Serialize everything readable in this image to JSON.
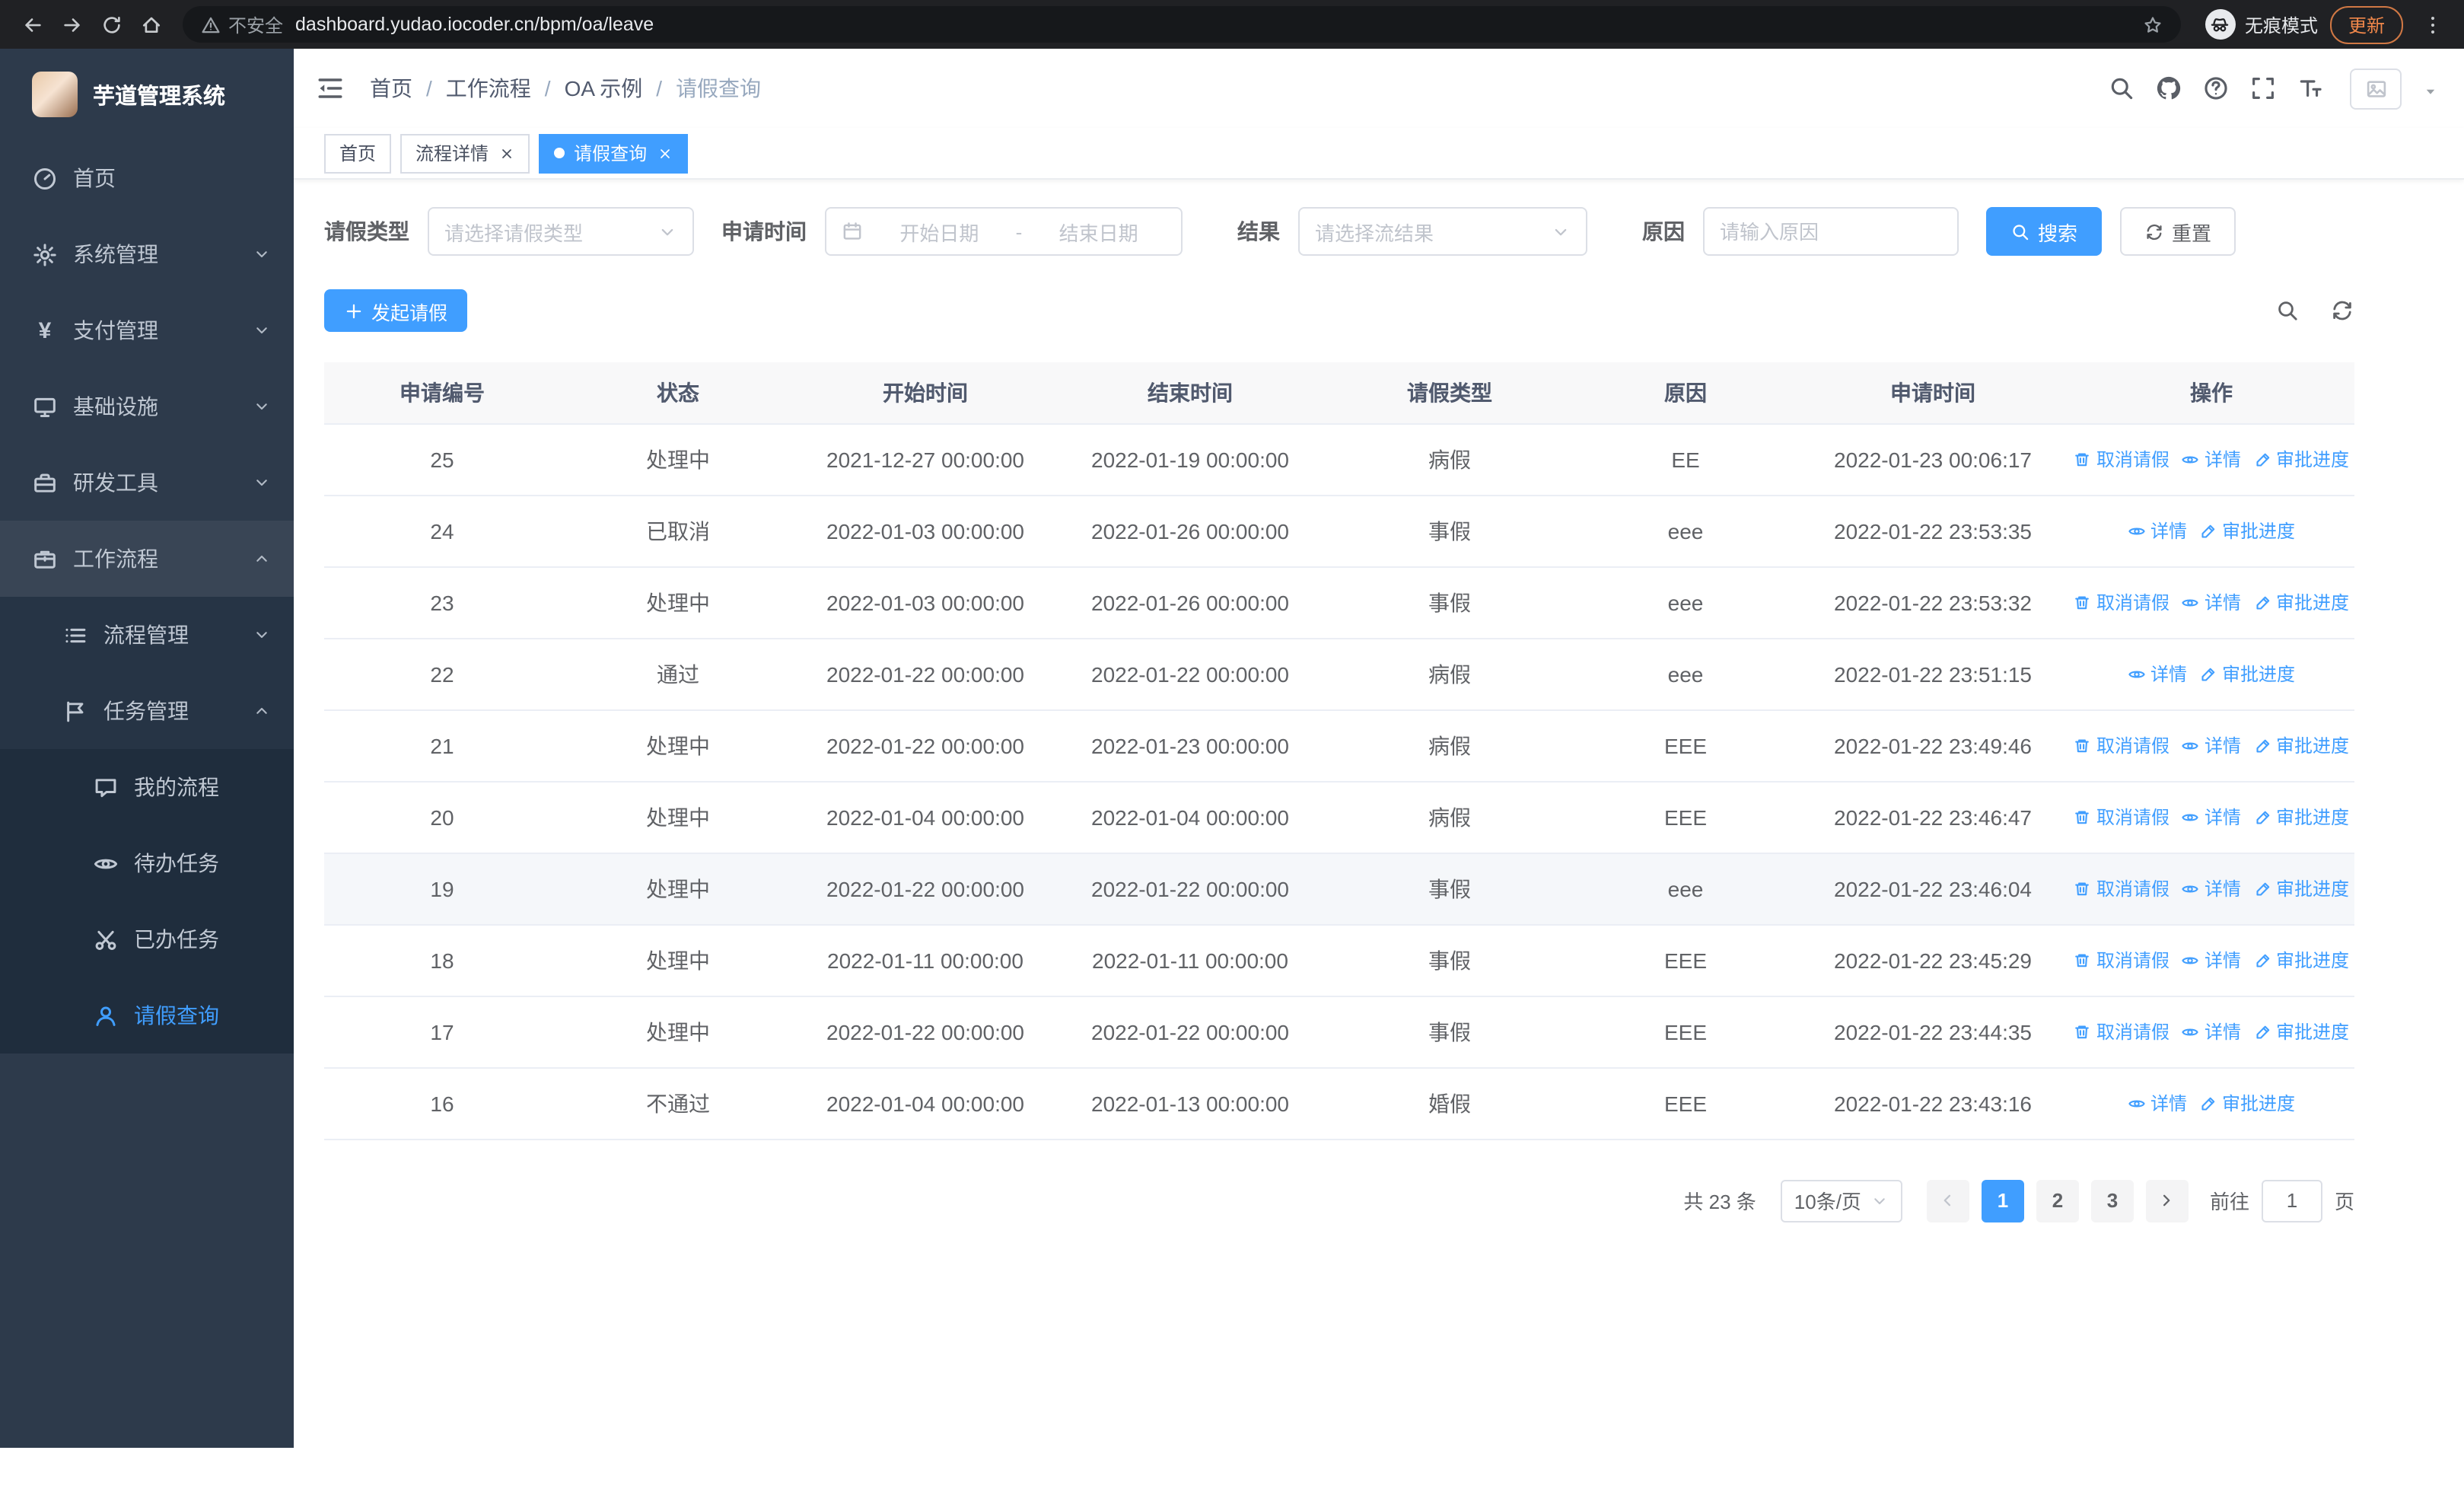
{
  "browser": {
    "security_warning": "不安全",
    "url": "dashboard.yudao.iocoder.cn/bpm/oa/leave",
    "incognito_label": "无痕模式",
    "update_button": "更新"
  },
  "sidebar": {
    "app_title": "芋道管理系统",
    "items": [
      {
        "label": "首页",
        "icon": "dashboard-icon",
        "level": 1
      },
      {
        "label": "系统管理",
        "icon": "gear-icon",
        "level": 1,
        "chevron": "down"
      },
      {
        "label": "支付管理",
        "icon": "yen-icon",
        "level": 1,
        "chevron": "down"
      },
      {
        "label": "基础设施",
        "icon": "monitor-icon",
        "level": 1,
        "chevron": "down"
      },
      {
        "label": "研发工具",
        "icon": "toolbox-icon",
        "level": 1,
        "chevron": "down"
      },
      {
        "label": "工作流程",
        "icon": "briefcase-icon",
        "level": 1,
        "chevron": "up",
        "highlight": true
      },
      {
        "label": "流程管理",
        "icon": "list-icon",
        "level": 2,
        "chevron": "down"
      },
      {
        "label": "任务管理",
        "icon": "flag-icon",
        "level": 2,
        "chevron": "up"
      },
      {
        "label": "我的流程",
        "icon": "chat-icon",
        "level": 3
      },
      {
        "label": "待办任务",
        "icon": "eye-icon",
        "level": 3
      },
      {
        "label": "已办任务",
        "icon": "scissors-icon",
        "level": 3
      },
      {
        "label": "请假查询",
        "icon": "user-icon",
        "level": 3,
        "active": true
      }
    ]
  },
  "header": {
    "breadcrumb": [
      "首页",
      "工作流程",
      "OA 示例",
      "请假查询"
    ],
    "breadcrumb_separator": "/"
  },
  "tabs": [
    {
      "label": "首页",
      "closable": false,
      "active": false
    },
    {
      "label": "流程详情",
      "closable": true,
      "active": false
    },
    {
      "label": "请假查询",
      "closable": true,
      "active": true
    }
  ],
  "filters": {
    "leave_type_label": "请假类型",
    "leave_type_placeholder": "请选择请假类型",
    "apply_time_label": "申请时间",
    "start_date_placeholder": "开始日期",
    "range_separator": "-",
    "end_date_placeholder": "结束日期",
    "result_label": "结果",
    "result_placeholder": "请选择流结果",
    "reason_label": "原因",
    "reason_placeholder": "请输入原因",
    "search_button": "搜索",
    "reset_button": "重置"
  },
  "toolbar": {
    "create_button": "发起请假"
  },
  "table": {
    "columns": [
      "申请编号",
      "状态",
      "开始时间",
      "结束时间",
      "请假类型",
      "原因",
      "申请时间",
      "操作"
    ],
    "actions": {
      "cancel": "取消请假",
      "detail": "详情",
      "progress": "审批进度"
    },
    "rows": [
      {
        "id": "25",
        "status": "处理中",
        "start": "2021-12-27 00:00:00",
        "end": "2022-01-19 00:00:00",
        "type": "病假",
        "reason": "EE",
        "applied": "2022-01-23 00:06:17",
        "cancellable": true,
        "highlighted": false
      },
      {
        "id": "24",
        "status": "已取消",
        "start": "2022-01-03 00:00:00",
        "end": "2022-01-26 00:00:00",
        "type": "事假",
        "reason": "eee",
        "applied": "2022-01-22 23:53:35",
        "cancellable": false,
        "highlighted": false
      },
      {
        "id": "23",
        "status": "处理中",
        "start": "2022-01-03 00:00:00",
        "end": "2022-01-26 00:00:00",
        "type": "事假",
        "reason": "eee",
        "applied": "2022-01-22 23:53:32",
        "cancellable": true,
        "highlighted": false
      },
      {
        "id": "22",
        "status": "通过",
        "start": "2022-01-22 00:00:00",
        "end": "2022-01-22 00:00:00",
        "type": "病假",
        "reason": "eee",
        "applied": "2022-01-22 23:51:15",
        "cancellable": false,
        "highlighted": false
      },
      {
        "id": "21",
        "status": "处理中",
        "start": "2022-01-22 00:00:00",
        "end": "2022-01-23 00:00:00",
        "type": "病假",
        "reason": "EEE",
        "applied": "2022-01-22 23:49:46",
        "cancellable": true,
        "highlighted": false
      },
      {
        "id": "20",
        "status": "处理中",
        "start": "2022-01-04 00:00:00",
        "end": "2022-01-04 00:00:00",
        "type": "病假",
        "reason": "EEE",
        "applied": "2022-01-22 23:46:47",
        "cancellable": true,
        "highlighted": false
      },
      {
        "id": "19",
        "status": "处理中",
        "start": "2022-01-22 00:00:00",
        "end": "2022-01-22 00:00:00",
        "type": "事假",
        "reason": "eee",
        "applied": "2022-01-22 23:46:04",
        "cancellable": true,
        "highlighted": true
      },
      {
        "id": "18",
        "status": "处理中",
        "start": "2022-01-11 00:00:00",
        "end": "2022-01-11 00:00:00",
        "type": "事假",
        "reason": "EEE",
        "applied": "2022-01-22 23:45:29",
        "cancellable": true,
        "highlighted": false
      },
      {
        "id": "17",
        "status": "处理中",
        "start": "2022-01-22 00:00:00",
        "end": "2022-01-22 00:00:00",
        "type": "事假",
        "reason": "EEE",
        "applied": "2022-01-22 23:44:35",
        "cancellable": true,
        "highlighted": false
      },
      {
        "id": "16",
        "status": "不通过",
        "start": "2022-01-04 00:00:00",
        "end": "2022-01-13 00:00:00",
        "type": "婚假",
        "reason": "EEE",
        "applied": "2022-01-22 23:43:16",
        "cancellable": false,
        "highlighted": false
      }
    ]
  },
  "pagination": {
    "total": "共 23 条",
    "page_size": "10条/页",
    "pages": [
      "1",
      "2",
      "3"
    ],
    "active_page": "1",
    "goto_label": "前往",
    "goto_value": "1",
    "page_unit": "页"
  },
  "colors": {
    "primary": "#409eff",
    "sidebar_bg": "#2d3a4b",
    "table_header_bg": "#f8f8f9"
  }
}
